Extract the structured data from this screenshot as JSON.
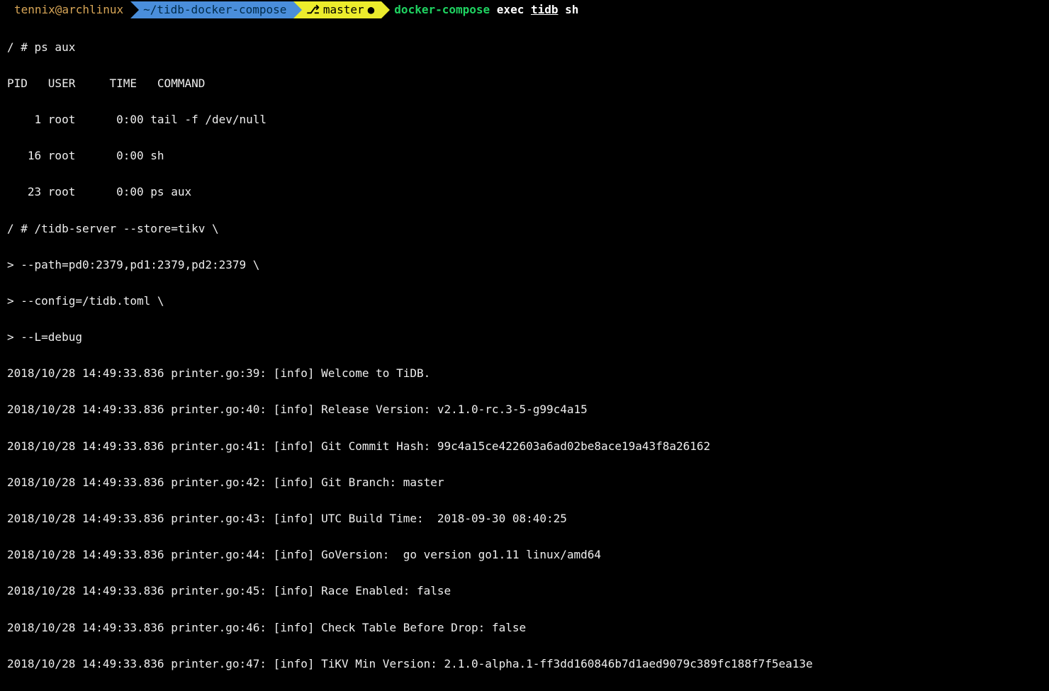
{
  "prompt": {
    "userhost": "tennix@archlinux",
    "path": "~/tidb-docker-compose",
    "branch_icon": "⎇",
    "branch": "master",
    "dirty_mark": "●",
    "cmd_main": "docker-compose",
    "cmd_sub1": "exec",
    "cmd_target": "tidb",
    "cmd_sub2": "sh"
  },
  "lines": [
    "/ # ps aux",
    "PID   USER     TIME   COMMAND",
    "    1 root      0:00 tail -f /dev/null",
    "   16 root      0:00 sh",
    "   23 root      0:00 ps aux",
    "/ # /tidb-server --store=tikv \\",
    "> --path=pd0:2379,pd1:2379,pd2:2379 \\",
    "> --config=/tidb.toml \\",
    "> --L=debug",
    "2018/10/28 14:49:33.836 printer.go:39: [info] Welcome to TiDB.",
    "2018/10/28 14:49:33.836 printer.go:40: [info] Release Version: v2.1.0-rc.3-5-g99c4a15",
    "2018/10/28 14:49:33.836 printer.go:41: [info] Git Commit Hash: 99c4a15ce422603a6ad02be8ace19a43f8a26162",
    "2018/10/28 14:49:33.836 printer.go:42: [info] Git Branch: master",
    "2018/10/28 14:49:33.836 printer.go:43: [info] UTC Build Time:  2018-09-30 08:40:25",
    "2018/10/28 14:49:33.836 printer.go:44: [info] GoVersion:  go version go1.11 linux/amd64",
    "2018/10/28 14:49:33.836 printer.go:45: [info] Race Enabled: false",
    "2018/10/28 14:49:33.836 printer.go:46: [info] Check Table Before Drop: false",
    "2018/10/28 14:49:33.836 printer.go:47: [info] TiKV Min Version: 2.1.0-alpha.1-ff3dd160846b7d1aed9079c389fc188f7f5ea13e"
  ]
}
